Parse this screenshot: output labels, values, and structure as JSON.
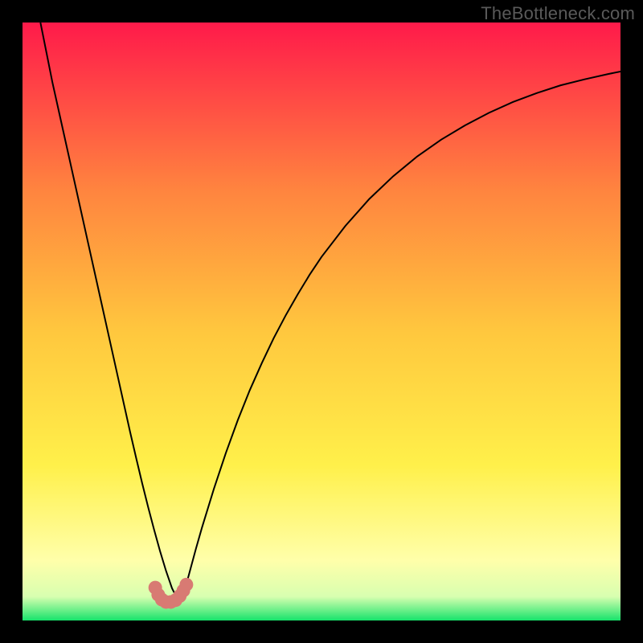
{
  "watermark": "TheBottleneck.com",
  "colors": {
    "top": "#ff1a4a",
    "upper_mid": "#ff843f",
    "mid": "#ffc83e",
    "lower_mid": "#fff04a",
    "pale": "#ffffaa",
    "green": "#17e36b",
    "curve": "#000000",
    "marker": "#d87a73"
  },
  "chart_data": {
    "type": "line",
    "title": "",
    "xlabel": "",
    "ylabel": "",
    "xlim": [
      0,
      100
    ],
    "ylim": [
      0,
      100
    ],
    "min_x": 24,
    "series": [
      {
        "name": "curve",
        "x": [
          3,
          4,
          5,
          6,
          7,
          8,
          9,
          10,
          11,
          12,
          13,
          14,
          15,
          16,
          17,
          18,
          19,
          20,
          21,
          22,
          23,
          24,
          25,
          26,
          27,
          28,
          29,
          30,
          32,
          34,
          36,
          38,
          40,
          42,
          44,
          46,
          48,
          50,
          54,
          58,
          62,
          66,
          70,
          74,
          78,
          82,
          86,
          90,
          94,
          98,
          100
        ],
        "y": [
          100,
          95,
          90,
          85.5,
          81,
          76.5,
          72,
          67.5,
          63,
          58.5,
          54,
          49.5,
          45,
          40.5,
          36,
          31.5,
          27.2,
          23,
          19,
          15.2,
          11.6,
          8.3,
          5.4,
          3.4,
          4.6,
          8.3,
          12,
          15.5,
          22,
          28,
          33.5,
          38.5,
          43,
          47.2,
          51,
          54.5,
          57.8,
          60.8,
          66,
          70.5,
          74.3,
          77.6,
          80.4,
          82.8,
          84.9,
          86.7,
          88.2,
          89.5,
          90.5,
          91.4,
          91.8
        ]
      }
    ],
    "markers": {
      "name": "fit-region",
      "x": [
        22.2,
        22.7,
        23.3,
        24.0,
        24.8,
        25.6,
        26.3,
        26.9,
        27.4
      ],
      "y": [
        5.5,
        4.3,
        3.5,
        3.1,
        3.1,
        3.4,
        4.1,
        5.0,
        6.0
      ]
    }
  }
}
